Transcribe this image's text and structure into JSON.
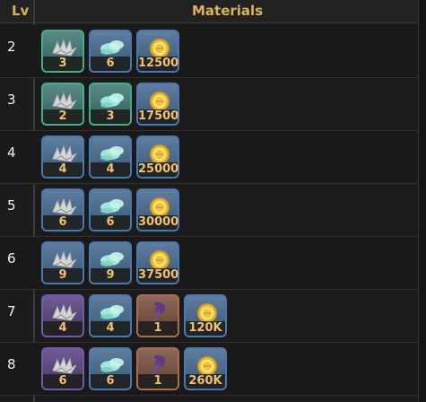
{
  "header": {
    "lv_label": "Lv",
    "materials_label": "Materials"
  },
  "rows": [
    {
      "level": "2",
      "items": [
        {
          "icon": "shell-icon",
          "count": "3",
          "rarity": "green"
        },
        {
          "icon": "crystal-icon",
          "count": "6",
          "rarity": "blue"
        },
        {
          "icon": "coin-icon",
          "count": "12500",
          "rarity": "blue"
        }
      ]
    },
    {
      "level": "3",
      "items": [
        {
          "icon": "shell-icon",
          "count": "2",
          "rarity": "green"
        },
        {
          "icon": "crystal-icon",
          "count": "3",
          "rarity": "green"
        },
        {
          "icon": "coin-icon",
          "count": "17500",
          "rarity": "blue"
        }
      ]
    },
    {
      "level": "4",
      "items": [
        {
          "icon": "shell-icon",
          "count": "4",
          "rarity": "blue"
        },
        {
          "icon": "crystal-icon",
          "count": "4",
          "rarity": "blue"
        },
        {
          "icon": "coin-icon",
          "count": "25000",
          "rarity": "blue"
        }
      ]
    },
    {
      "level": "5",
      "items": [
        {
          "icon": "shell-icon",
          "count": "6",
          "rarity": "blue"
        },
        {
          "icon": "crystal-icon",
          "count": "6",
          "rarity": "blue"
        },
        {
          "icon": "coin-icon",
          "count": "30000",
          "rarity": "blue"
        }
      ]
    },
    {
      "level": "6",
      "items": [
        {
          "icon": "shell-icon",
          "count": "9",
          "rarity": "blue"
        },
        {
          "icon": "crystal-icon",
          "count": "9",
          "rarity": "blue"
        },
        {
          "icon": "coin-icon",
          "count": "37500",
          "rarity": "blue"
        }
      ]
    },
    {
      "level": "7",
      "items": [
        {
          "icon": "shell-icon",
          "count": "4",
          "rarity": "purple"
        },
        {
          "icon": "crystal-icon",
          "count": "4",
          "rarity": "blue"
        },
        {
          "icon": "tentacle-icon",
          "count": "1",
          "rarity": "orange"
        },
        {
          "icon": "coin-icon",
          "count": "120K",
          "rarity": "blue"
        }
      ]
    },
    {
      "level": "8",
      "items": [
        {
          "icon": "shell-icon",
          "count": "6",
          "rarity": "purple"
        },
        {
          "icon": "crystal-icon",
          "count": "6",
          "rarity": "blue"
        },
        {
          "icon": "tentacle-icon",
          "count": "1",
          "rarity": "orange"
        },
        {
          "icon": "coin-icon",
          "count": "260K",
          "rarity": "blue"
        }
      ]
    }
  ]
}
